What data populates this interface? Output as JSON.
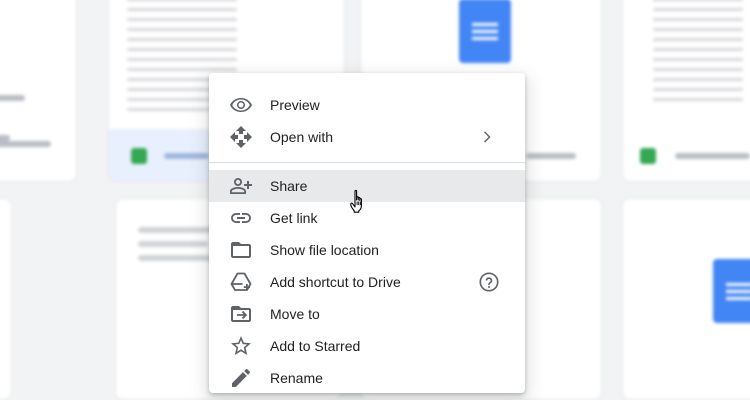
{
  "menu": {
    "items": [
      {
        "label": "Preview",
        "icon": "eye-icon"
      },
      {
        "label": "Open with",
        "icon": "move-arrows-icon",
        "has_submenu": true
      },
      {
        "label": "Share",
        "icon": "person-add-icon",
        "hovered": true
      },
      {
        "label": "Get link",
        "icon": "link-icon"
      },
      {
        "label": "Show file location",
        "icon": "folder-icon"
      },
      {
        "label": "Add shortcut to Drive",
        "icon": "drive-shortcut-icon",
        "help_icon": "help-circle-icon"
      },
      {
        "label": "Move to",
        "icon": "move-to-folder-icon"
      },
      {
        "label": "Add to Starred",
        "icon": "star-outline-icon"
      },
      {
        "label": "Rename",
        "icon": "pencil-icon"
      }
    ]
  },
  "colors": {
    "menu_bg": "#ffffff",
    "hover_bg": "#e8e9ea",
    "icon": "#5f6368",
    "text": "#202124",
    "doc_blue": "#4285f4",
    "sheet_green": "#34a853"
  }
}
